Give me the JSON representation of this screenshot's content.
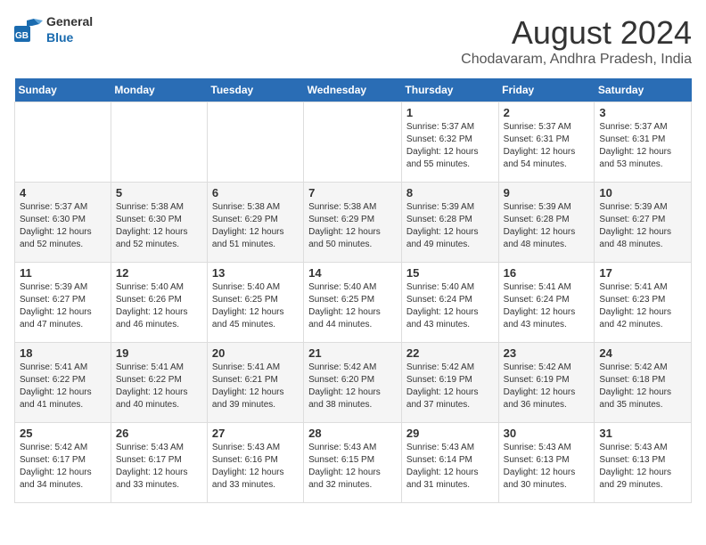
{
  "header": {
    "logo_general": "General",
    "logo_blue": "Blue",
    "month_year": "August 2024",
    "location": "Chodavaram, Andhra Pradesh, India"
  },
  "weekdays": [
    "Sunday",
    "Monday",
    "Tuesday",
    "Wednesday",
    "Thursday",
    "Friday",
    "Saturday"
  ],
  "weeks": [
    [
      {
        "day": "",
        "info": ""
      },
      {
        "day": "",
        "info": ""
      },
      {
        "day": "",
        "info": ""
      },
      {
        "day": "",
        "info": ""
      },
      {
        "day": "1",
        "info": "Sunrise: 5:37 AM\nSunset: 6:32 PM\nDaylight: 12 hours\nand 55 minutes."
      },
      {
        "day": "2",
        "info": "Sunrise: 5:37 AM\nSunset: 6:31 PM\nDaylight: 12 hours\nand 54 minutes."
      },
      {
        "day": "3",
        "info": "Sunrise: 5:37 AM\nSunset: 6:31 PM\nDaylight: 12 hours\nand 53 minutes."
      }
    ],
    [
      {
        "day": "4",
        "info": "Sunrise: 5:37 AM\nSunset: 6:30 PM\nDaylight: 12 hours\nand 52 minutes."
      },
      {
        "day": "5",
        "info": "Sunrise: 5:38 AM\nSunset: 6:30 PM\nDaylight: 12 hours\nand 52 minutes."
      },
      {
        "day": "6",
        "info": "Sunrise: 5:38 AM\nSunset: 6:29 PM\nDaylight: 12 hours\nand 51 minutes."
      },
      {
        "day": "7",
        "info": "Sunrise: 5:38 AM\nSunset: 6:29 PM\nDaylight: 12 hours\nand 50 minutes."
      },
      {
        "day": "8",
        "info": "Sunrise: 5:39 AM\nSunset: 6:28 PM\nDaylight: 12 hours\nand 49 minutes."
      },
      {
        "day": "9",
        "info": "Sunrise: 5:39 AM\nSunset: 6:28 PM\nDaylight: 12 hours\nand 48 minutes."
      },
      {
        "day": "10",
        "info": "Sunrise: 5:39 AM\nSunset: 6:27 PM\nDaylight: 12 hours\nand 48 minutes."
      }
    ],
    [
      {
        "day": "11",
        "info": "Sunrise: 5:39 AM\nSunset: 6:27 PM\nDaylight: 12 hours\nand 47 minutes."
      },
      {
        "day": "12",
        "info": "Sunrise: 5:40 AM\nSunset: 6:26 PM\nDaylight: 12 hours\nand 46 minutes."
      },
      {
        "day": "13",
        "info": "Sunrise: 5:40 AM\nSunset: 6:25 PM\nDaylight: 12 hours\nand 45 minutes."
      },
      {
        "day": "14",
        "info": "Sunrise: 5:40 AM\nSunset: 6:25 PM\nDaylight: 12 hours\nand 44 minutes."
      },
      {
        "day": "15",
        "info": "Sunrise: 5:40 AM\nSunset: 6:24 PM\nDaylight: 12 hours\nand 43 minutes."
      },
      {
        "day": "16",
        "info": "Sunrise: 5:41 AM\nSunset: 6:24 PM\nDaylight: 12 hours\nand 43 minutes."
      },
      {
        "day": "17",
        "info": "Sunrise: 5:41 AM\nSunset: 6:23 PM\nDaylight: 12 hours\nand 42 minutes."
      }
    ],
    [
      {
        "day": "18",
        "info": "Sunrise: 5:41 AM\nSunset: 6:22 PM\nDaylight: 12 hours\nand 41 minutes."
      },
      {
        "day": "19",
        "info": "Sunrise: 5:41 AM\nSunset: 6:22 PM\nDaylight: 12 hours\nand 40 minutes."
      },
      {
        "day": "20",
        "info": "Sunrise: 5:41 AM\nSunset: 6:21 PM\nDaylight: 12 hours\nand 39 minutes."
      },
      {
        "day": "21",
        "info": "Sunrise: 5:42 AM\nSunset: 6:20 PM\nDaylight: 12 hours\nand 38 minutes."
      },
      {
        "day": "22",
        "info": "Sunrise: 5:42 AM\nSunset: 6:19 PM\nDaylight: 12 hours\nand 37 minutes."
      },
      {
        "day": "23",
        "info": "Sunrise: 5:42 AM\nSunset: 6:19 PM\nDaylight: 12 hours\nand 36 minutes."
      },
      {
        "day": "24",
        "info": "Sunrise: 5:42 AM\nSunset: 6:18 PM\nDaylight: 12 hours\nand 35 minutes."
      }
    ],
    [
      {
        "day": "25",
        "info": "Sunrise: 5:42 AM\nSunset: 6:17 PM\nDaylight: 12 hours\nand 34 minutes."
      },
      {
        "day": "26",
        "info": "Sunrise: 5:43 AM\nSunset: 6:17 PM\nDaylight: 12 hours\nand 33 minutes."
      },
      {
        "day": "27",
        "info": "Sunrise: 5:43 AM\nSunset: 6:16 PM\nDaylight: 12 hours\nand 33 minutes."
      },
      {
        "day": "28",
        "info": "Sunrise: 5:43 AM\nSunset: 6:15 PM\nDaylight: 12 hours\nand 32 minutes."
      },
      {
        "day": "29",
        "info": "Sunrise: 5:43 AM\nSunset: 6:14 PM\nDaylight: 12 hours\nand 31 minutes."
      },
      {
        "day": "30",
        "info": "Sunrise: 5:43 AM\nSunset: 6:13 PM\nDaylight: 12 hours\nand 30 minutes."
      },
      {
        "day": "31",
        "info": "Sunrise: 5:43 AM\nSunset: 6:13 PM\nDaylight: 12 hours\nand 29 minutes."
      }
    ]
  ]
}
